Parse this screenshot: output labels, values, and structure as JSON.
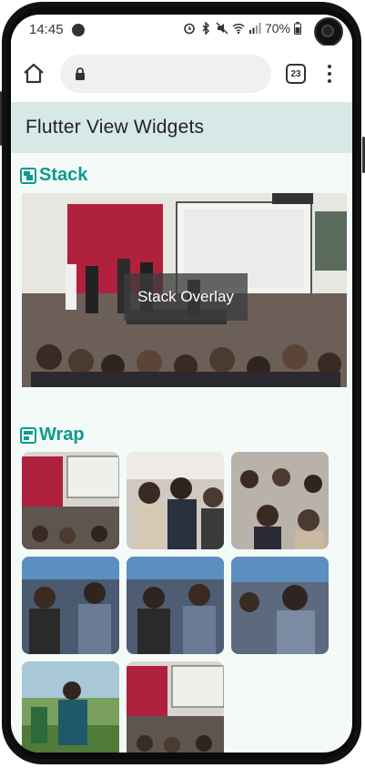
{
  "status_bar": {
    "time": "14:45",
    "battery": "70%"
  },
  "browser": {
    "tab_count": "23"
  },
  "app_bar": {
    "title": "Flutter View Widgets"
  },
  "sections": {
    "stack": {
      "title": "Stack",
      "overlay_text": "Stack Overlay"
    },
    "wrap": {
      "title": "Wrap",
      "image_count": 8
    }
  },
  "colors": {
    "accent": "#0d9b8c",
    "app_bar_bg": "#d7e9e6",
    "page_bg": "#f3faf8"
  }
}
